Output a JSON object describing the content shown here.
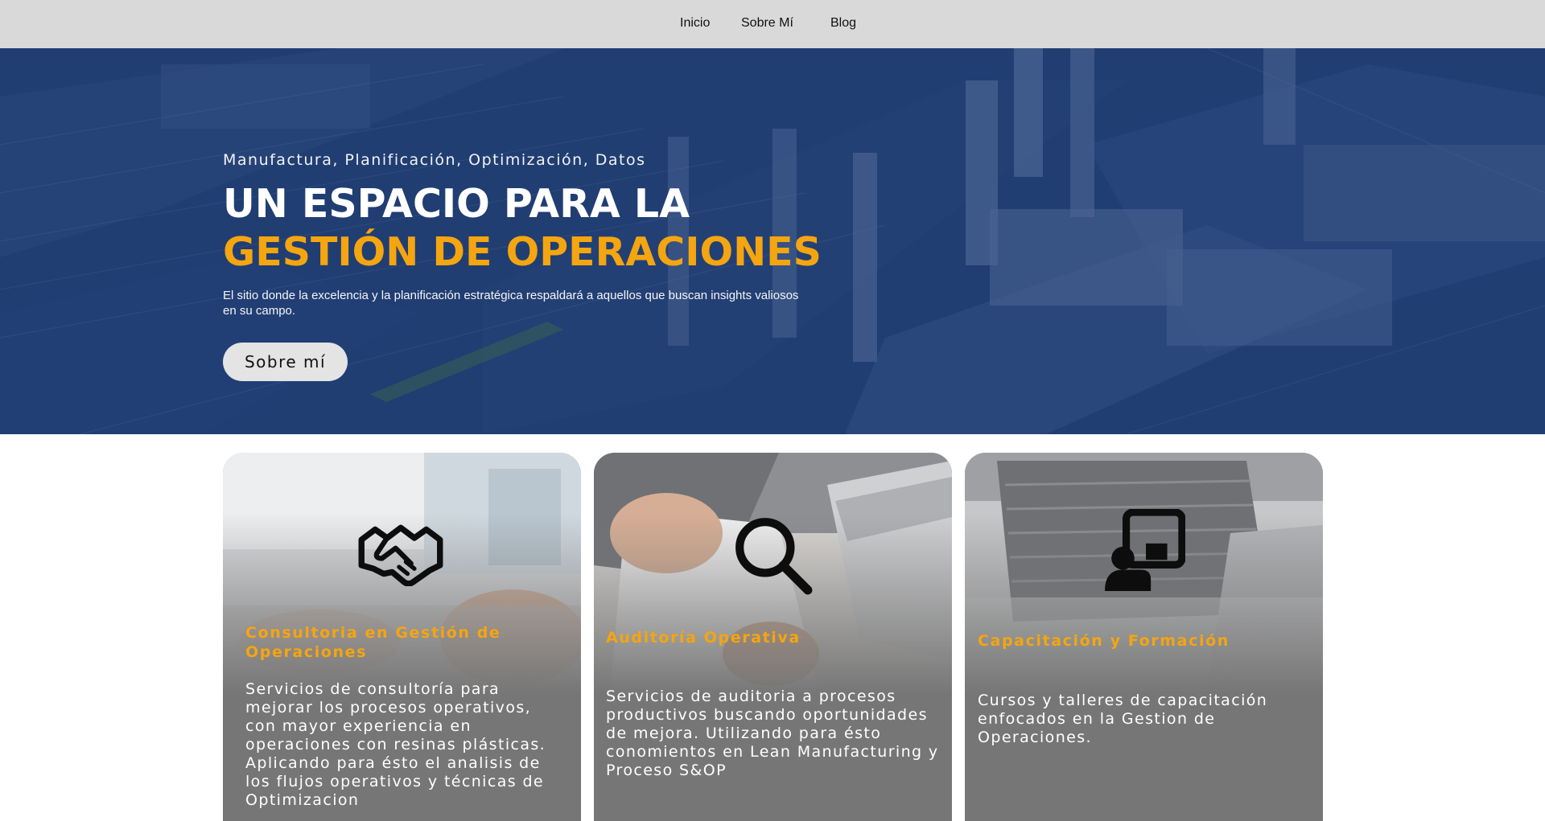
{
  "nav": {
    "items": [
      {
        "label": "Inicio"
      },
      {
        "label": "Sobre Mí"
      },
      {
        "label": "Blog"
      }
    ]
  },
  "hero": {
    "tagline": "Manufactura, Planificación, Optimización, Datos",
    "title_line1": "UN ESPACIO PARA LA",
    "title_line2": "GESTIÓN DE OPERACIONES",
    "description": "El sitio donde la excelencia y la planificación estratégica respaldará a aquellos que buscan insights valiosos en su campo.",
    "button_label": "Sobre mí"
  },
  "cards": [
    {
      "icon": "handshake-icon",
      "title": "Consultoria en Gestión de Operaciones",
      "text": "Servicios de consultoría para mejorar los procesos operativos, con mayor experiencia en operaciones con resinas plásticas. Aplicando para ésto el analisis de los flujos operativos y técnicas de Optimizacion"
    },
    {
      "icon": "magnifying-glass-icon",
      "title": "Auditoría Operativa",
      "text": "Servicios de auditoria a procesos productivos buscando oportunidades de mejora. Utilizando para ésto conomientos en Lean Manufacturing y Proceso S&OP"
    },
    {
      "icon": "presenter-board-icon",
      "title": "Capacitación y Formación",
      "text": "Cursos y talleres de capacitación enfocados en la Gestion de Operaciones."
    }
  ],
  "colors": {
    "accent": "#f5a510",
    "nav_bg": "#d9d9d9",
    "hero_overlay": "#1e3d6e",
    "card_bg": "#767676"
  }
}
